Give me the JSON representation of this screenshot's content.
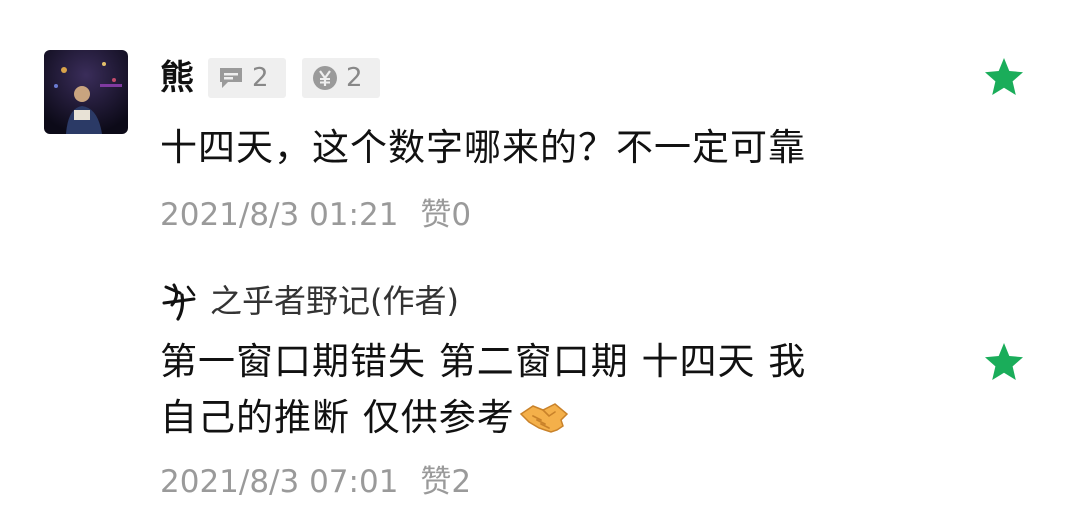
{
  "comment": {
    "username": "熊",
    "comment_count": "2",
    "reward_count": "2",
    "text": "十四天，这个数字哪来的？不一定可靠",
    "timestamp": "2021/8/3 01:21",
    "likes": "赞0",
    "starred": true,
    "star_color": "#1aad5a"
  },
  "reply": {
    "author": "之乎者野记(作者)",
    "text_line1": "第一窗口期错失 第二窗口期 十四天 我",
    "text_line2": "自己的推断 仅供参考",
    "emoji": "handshake-emoji",
    "timestamp": "2021/8/3 07:01",
    "likes": "赞2",
    "starred": true,
    "star_color": "#1aad5a"
  },
  "icons": {
    "comment_badge": "speech-bubble-icon",
    "reward_badge": "yen-coin-icon",
    "author_mark": "calligraphy-signature-icon",
    "favorite": "star-icon"
  },
  "colors": {
    "text_primary": "#111111",
    "text_secondary": "#9a9a9a",
    "badge_bg": "#efefef",
    "accent_green": "#1aad5a"
  }
}
